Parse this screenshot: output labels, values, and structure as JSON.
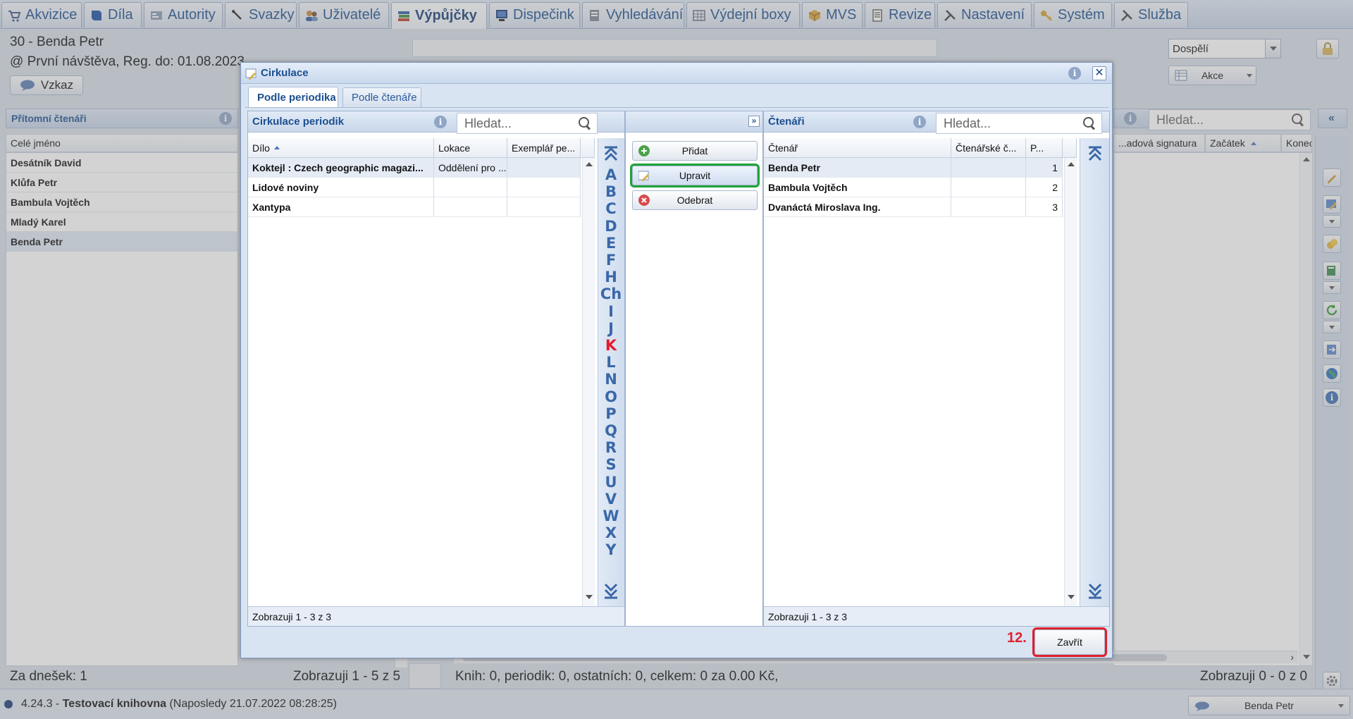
{
  "nav": {
    "tabs": [
      {
        "label": "Akvizice",
        "icon": "cart-icon"
      },
      {
        "label": "Díla",
        "icon": "book-icon"
      },
      {
        "label": "Autority",
        "icon": "card-icon"
      },
      {
        "label": "Svazky",
        "icon": "pen-icon"
      },
      {
        "label": "Uživatelé",
        "icon": "users-icon"
      },
      {
        "label": "Výpůjčky",
        "icon": "books-icon"
      },
      {
        "label": "Dispečink",
        "icon": "monitor-icon"
      },
      {
        "label": "Vyhledávání",
        "icon": "search-doc-icon"
      },
      {
        "label": "Výdejní boxy",
        "icon": "boxes-icon"
      },
      {
        "label": "MVS",
        "icon": "package-icon"
      },
      {
        "label": "Revize",
        "icon": "document-icon"
      },
      {
        "label": "Nastavení",
        "icon": "tools-icon"
      },
      {
        "label": "Systém",
        "icon": "key-icon"
      },
      {
        "label": "Služba",
        "icon": "tools-icon"
      }
    ]
  },
  "page": {
    "user_line": "30 - Benda Petr",
    "visit_line": "@ První návštěva, Reg. do: 01.08.2023",
    "message_button": "Vzkaz",
    "category_select": "Dospělí",
    "actions_button": "Akce",
    "present_readers": {
      "title": "Přítomní čtenáři",
      "column": "Celé jméno",
      "rows": [
        "Desátník David",
        "Klůfa Petr",
        "Bambula Vojtěch",
        "Mladý Karel",
        "Benda Petr"
      ]
    },
    "right_list": {
      "search_placeholder": "Hledat...",
      "col_signature": "...adová signatura",
      "col_start": "Začátek",
      "col_end": "Konec"
    },
    "footer_today": "Za dnešek: 1",
    "footer_showing_left": "Zobrazuji 1 - 5 z 5",
    "footer_summary": "Knih: 0, periodik: 0, ostatních: 0, celkem: 0 za 0.00 Kč,",
    "footer_showing_right": "Zobrazuji 0 - 0 z 0"
  },
  "statusbar": {
    "version": "4.24.3 - ",
    "library": "Testovací knihovna",
    "last_login": " (Naposledy 21.07.2022 08:28:25)",
    "user_button": "Benda Petr"
  },
  "dialog": {
    "title": "Cirkulace",
    "tabs": [
      "Podle periodika",
      "Podle čtenáře"
    ],
    "left": {
      "title": "Cirkulace periodik",
      "search_placeholder": "Hledat...",
      "columns": [
        "Dílo",
        "Lokace",
        "Exemplář pe..."
      ],
      "rows": [
        {
          "work": "Koktejl : Czech geographic magazi...",
          "location": "Oddělení pro ...",
          "copy": ""
        },
        {
          "work": "Lidové noviny",
          "location": "",
          "copy": ""
        },
        {
          "work": "Xantypa",
          "location": "",
          "copy": ""
        }
      ],
      "footer": "Zobrazuji 1 - 3 z 3",
      "alphabet": [
        "A",
        "B",
        "C",
        "D",
        "E",
        "F",
        "H",
        "Ch",
        "I",
        "J",
        "K",
        "L",
        "N",
        "O",
        "P",
        "Q",
        "R",
        "S",
        "U",
        "V",
        "W",
        "X",
        "Y"
      ],
      "selected_letter": "K"
    },
    "actions": {
      "add": "Přidat",
      "edit": "Upravit",
      "remove": "Odebrat"
    },
    "right": {
      "title": "Čtenáři",
      "search_placeholder": "Hledat...",
      "columns": [
        "Čtenář",
        "Čtenářské č...",
        "P..."
      ],
      "rows": [
        {
          "reader": "Benda Petr",
          "card": "",
          "order": "1"
        },
        {
          "reader": "Bambula Vojtěch",
          "card": "",
          "order": "2"
        },
        {
          "reader": "Dvanáctá Miroslava Ing.",
          "card": "",
          "order": "3"
        }
      ],
      "footer": "Zobrazuji 1 - 3 z 3"
    },
    "step_label": "12.",
    "close_button": "Zavřít",
    "colors": {
      "highlight_green": "#1fa33a",
      "highlight_red": "#e0202c",
      "selected_letter": "#e8192c"
    }
  }
}
